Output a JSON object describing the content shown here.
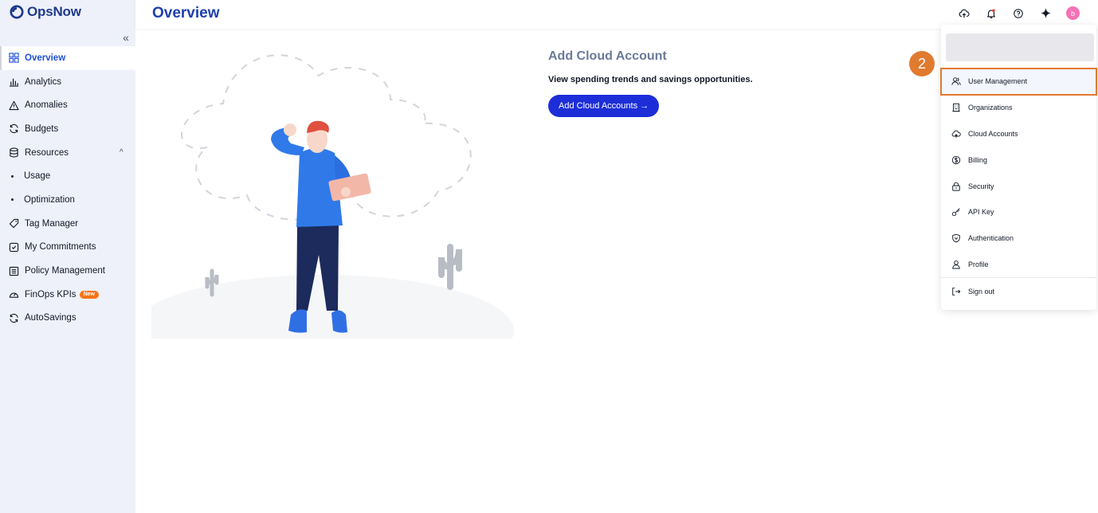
{
  "app": {
    "logo_text": "OpsNow",
    "page_title": "Overview"
  },
  "sidebar": {
    "collapse_label": "«",
    "items": [
      {
        "label": "Overview",
        "icon": "grid-icon"
      },
      {
        "label": "Analytics",
        "icon": "bar-chart-icon"
      },
      {
        "label": "Anomalies",
        "icon": "warning-icon"
      },
      {
        "label": "Budgets",
        "icon": "refresh-icon"
      },
      {
        "label": "Resources",
        "icon": "database-icon"
      },
      {
        "label": "Usage",
        "icon": "bullet"
      },
      {
        "label": "Optimization",
        "icon": "bullet"
      },
      {
        "label": "Tag Manager",
        "icon": "tag-icon"
      },
      {
        "label": "My Commitments",
        "icon": "checkbox-icon"
      },
      {
        "label": "Policy Management",
        "icon": "list-icon"
      },
      {
        "label": "FinOps KPIs",
        "icon": "gauge-icon",
        "badge": "New"
      },
      {
        "label": "AutoSavings",
        "icon": "refresh-icon"
      }
    ]
  },
  "header": {
    "avatar_initial": "b"
  },
  "main": {
    "title": "Add Cloud Account",
    "description": "View spending trends and savings opportunities.",
    "cta_label": "Add Cloud Accounts →"
  },
  "dropdown": {
    "items": [
      {
        "label": "User Management",
        "icon": "users-icon"
      },
      {
        "label": "Organizations",
        "icon": "building-icon"
      },
      {
        "label": "Cloud Accounts",
        "icon": "cloud-icon"
      },
      {
        "label": "Billing",
        "icon": "dollar-icon"
      },
      {
        "label": "Security",
        "icon": "lock-icon"
      },
      {
        "label": "API Key",
        "icon": "key-icon"
      },
      {
        "label": "Authentication",
        "icon": "shield-icon"
      },
      {
        "label": "Profile",
        "icon": "user-icon"
      },
      {
        "label": "Sign out",
        "icon": "sign-out-icon"
      }
    ]
  },
  "annotation": {
    "step_number": "2"
  },
  "colors": {
    "brand": "#1d4ed8",
    "cta": "#1d2ed8",
    "highlight": "#e07a2f"
  }
}
